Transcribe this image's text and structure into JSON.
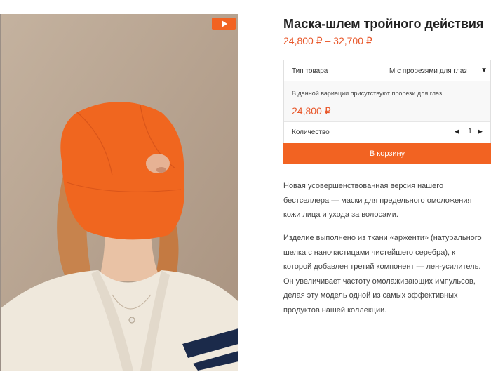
{
  "product": {
    "title": "Маска-шлем тройного действия",
    "price_range": "24,800 ₽ – 32,700 ₽"
  },
  "media": {
    "play_icon": "play-icon",
    "image_alt": "product photo"
  },
  "variation": {
    "type_label": "Тип товара",
    "selected_option": "M с прорезями для глаз",
    "dropdown_icon": "▼",
    "description": "В данной вариации присутствуют прорези для глаз.",
    "price": "24,800 ₽",
    "quantity_label": "Количество",
    "qty_dec_icon": "◀",
    "quantity": "1",
    "qty_inc_icon": "▶"
  },
  "cart": {
    "button_label": "В корзину"
  },
  "description": {
    "p1_lines": [
      "Новая усовершенствованная версия нашего",
      "бестселлера — маски для предельного омоложения",
      "кожи лица и ухода за волосами."
    ],
    "p2_lines": [
      "Изделие выполнено из ткани «арженти» (натурального",
      "шелка с наночастицами чистейшего серебра), к",
      "которой добавлен третий компонент — лен-усилитель.",
      "Он увеличивает частоту омолаживающих импульсов,",
      "делая эту модель одной из самых эффективных",
      "продуктов нашей коллекции."
    ]
  },
  "colors": {
    "accent": "#f26322",
    "price": "#e8572a",
    "mask": "#f0661f"
  }
}
